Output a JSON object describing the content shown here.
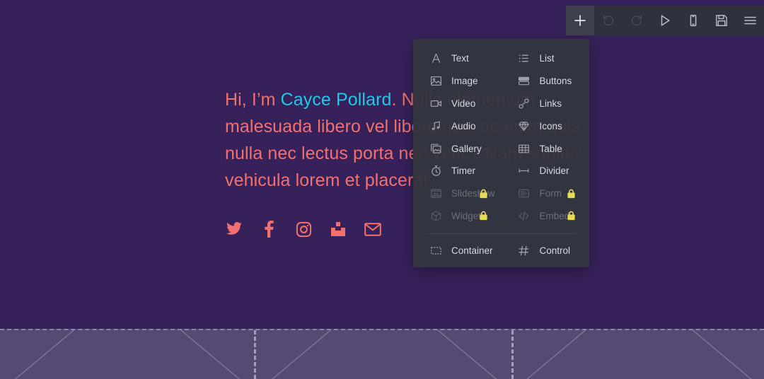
{
  "canvas": {
    "background_color": "#36215a",
    "headline": {
      "prefix": "Hi, I’m ",
      "accent": "Cayce Pollard",
      "accent_color": "#1ec9e8",
      "body_color": "#f4706e",
      "rest": ". Nulla elementum malesuada libero vel libero quis ac enim quis nulla nec lectus porta nec venc? Nam sagittis vehicula lorem et placerat."
    },
    "social": [
      {
        "name": "twitter",
        "label": "Twitter"
      },
      {
        "name": "facebook",
        "label": "Facebook"
      },
      {
        "name": "instagram",
        "label": "Instagram"
      },
      {
        "name": "blocks",
        "label": "Blocks"
      },
      {
        "name": "email",
        "label": "Email"
      }
    ]
  },
  "toolbar": {
    "background_color": "#2f323c",
    "buttons": [
      {
        "name": "add",
        "label": "Add",
        "icon": "plus-icon",
        "state": "active"
      },
      {
        "name": "undo",
        "label": "Undo",
        "icon": "undo-icon",
        "state": "disabled"
      },
      {
        "name": "redo",
        "label": "Redo",
        "icon": "redo-icon",
        "state": "disabled"
      },
      {
        "name": "preview",
        "label": "Preview",
        "icon": "play-icon",
        "state": "normal"
      },
      {
        "name": "responsive",
        "label": "Responsive",
        "icon": "mobile-icon",
        "state": "normal"
      },
      {
        "name": "save",
        "label": "Save",
        "icon": "save-icon",
        "state": "normal"
      },
      {
        "name": "menu",
        "label": "Menu",
        "icon": "hamburger-icon",
        "state": "normal"
      }
    ]
  },
  "insert_panel": {
    "background_color": "#32353f",
    "lock_color": "#e7dd55",
    "items": [
      {
        "label": "Text",
        "icon": "text-icon",
        "locked": false
      },
      {
        "label": "List",
        "icon": "list-icon",
        "locked": false
      },
      {
        "label": "Image",
        "icon": "image-icon",
        "locked": false
      },
      {
        "label": "Buttons",
        "icon": "buttons-icon",
        "locked": false
      },
      {
        "label": "Video",
        "icon": "video-icon",
        "locked": false
      },
      {
        "label": "Links",
        "icon": "links-icon",
        "locked": false
      },
      {
        "label": "Audio",
        "icon": "audio-icon",
        "locked": false
      },
      {
        "label": "Icons",
        "icon": "gem-icon",
        "locked": false
      },
      {
        "label": "Gallery",
        "icon": "gallery-icon",
        "locked": false
      },
      {
        "label": "Table",
        "icon": "table-icon",
        "locked": false
      },
      {
        "label": "Timer",
        "icon": "timer-icon",
        "locked": false
      },
      {
        "label": "Divider",
        "icon": "divider-icon",
        "locked": false
      },
      {
        "label": "Slideshow",
        "icon": "slideshow-icon",
        "locked": true
      },
      {
        "label": "Form",
        "icon": "form-icon",
        "locked": true
      },
      {
        "label": "Widget",
        "icon": "widget-icon",
        "locked": true
      },
      {
        "label": "Embed",
        "icon": "embed-icon",
        "locked": true
      }
    ],
    "bottom_items": [
      {
        "label": "Container",
        "icon": "container-icon",
        "locked": false
      },
      {
        "label": "Control",
        "icon": "control-icon",
        "locked": false
      }
    ]
  },
  "dropzone": {
    "background_color": "#554a72",
    "border_color": "#8d85a6",
    "columns": 3
  }
}
